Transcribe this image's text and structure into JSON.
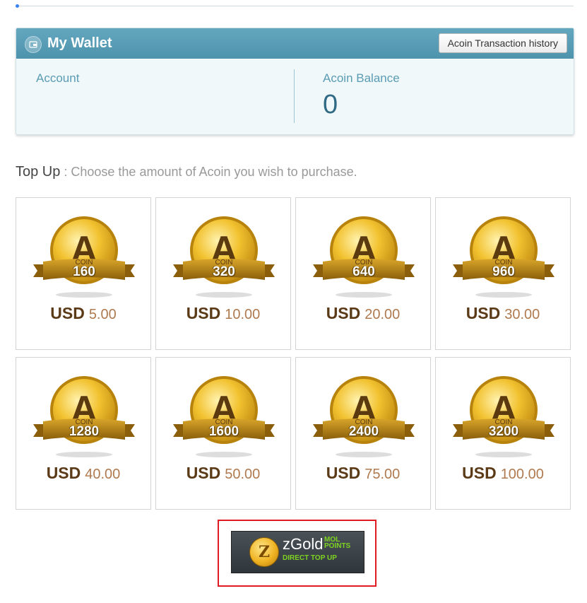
{
  "wallet": {
    "title": "My Wallet",
    "history_button": "Acoin Transaction history",
    "account_label": "Account",
    "account_value": "",
    "balance_label": "Acoin Balance",
    "balance_value": "0"
  },
  "topup": {
    "title": "Top Up",
    "subtitle": " : Choose the amount of Acoin you wish to purchase."
  },
  "coin_text": "COIN",
  "coin_letter": "A",
  "packages": [
    {
      "coins": "160",
      "currency": "USD",
      "price": "5.00"
    },
    {
      "coins": "320",
      "currency": "USD",
      "price": "10.00"
    },
    {
      "coins": "640",
      "currency": "USD",
      "price": "20.00"
    },
    {
      "coins": "960",
      "currency": "USD",
      "price": "30.00"
    },
    {
      "coins": "1280",
      "currency": "USD",
      "price": "40.00"
    },
    {
      "coins": "1600",
      "currency": "USD",
      "price": "50.00"
    },
    {
      "coins": "2400",
      "currency": "USD",
      "price": "75.00"
    },
    {
      "coins": "3200",
      "currency": "USD",
      "price": "100.00"
    }
  ],
  "zgold": {
    "name": "zGold",
    "badge": "MOL POINTS",
    "tagline": "DIRECT TOP UP",
    "coin_letter": "Z"
  },
  "colors": {
    "header": "#5a9eb7",
    "price_currency": "#5b3a17",
    "price_amount": "#b07a4f",
    "highlight_border": "#e01b24"
  }
}
